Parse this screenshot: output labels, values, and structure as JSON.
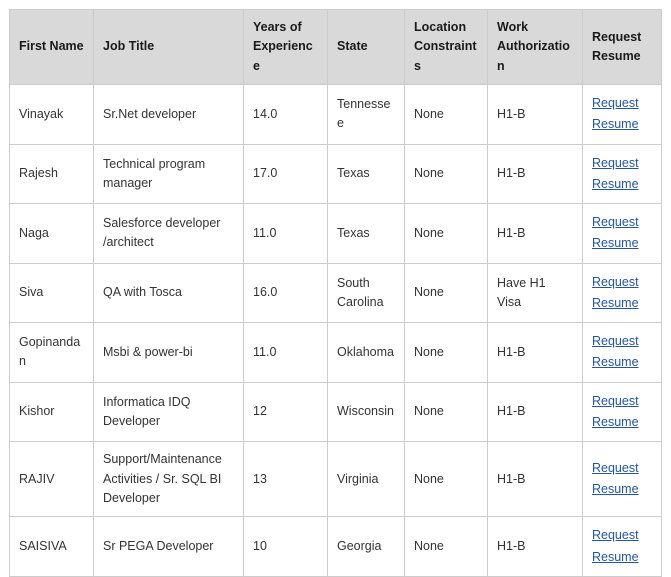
{
  "table": {
    "columns": [
      {
        "key": "first_name",
        "label": "First Name"
      },
      {
        "key": "job_title",
        "label": "Job Title"
      },
      {
        "key": "years",
        "label": "Years of Experience"
      },
      {
        "key": "state",
        "label": "State"
      },
      {
        "key": "location_constraints",
        "label": "Location Constraints"
      },
      {
        "key": "work_authorization",
        "label": "Work Authorization"
      },
      {
        "key": "request_resume",
        "label": "Request Resume"
      }
    ],
    "header": {
      "first_name": "First Name",
      "job_title": "Job Title",
      "years": "Years of Experience",
      "state": "State",
      "location_constraints": "Location Constraints",
      "work_authorization": "Work Authorization",
      "request_resume": "Request Resume"
    },
    "link_label": "Request Resume",
    "link_line_1": "Request",
    "link_line_2": "Resume",
    "link_color": "#2255aa",
    "header_bg": "#d9d9d9",
    "border_color": "#cccccc",
    "rows": [
      {
        "first_name": "Vinayak",
        "job_title": "Sr.Net developer",
        "years": "14.0",
        "state": "Tennessee",
        "location_constraints": "None",
        "work_authorization": "H1-B",
        "request_resume": "Request Resume"
      },
      {
        "first_name": "Rajesh",
        "job_title": "Technical program manager",
        "years": "17.0",
        "state": "Texas",
        "location_constraints": "None",
        "work_authorization": "H1-B",
        "request_resume": "Request Resume"
      },
      {
        "first_name": "Naga",
        "job_title": "Salesforce developer /architect",
        "years": "11.0",
        "state": "Texas",
        "location_constraints": "None",
        "work_authorization": "H1-B",
        "request_resume": "Request Resume"
      },
      {
        "first_name": "Siva",
        "job_title": "QA with Tosca",
        "years": "16.0",
        "state": "South Carolina",
        "location_constraints": "None",
        "work_authorization": "Have H1 Visa",
        "request_resume": "Request Resume"
      },
      {
        "first_name": "Gopinandan",
        "job_title": "Msbi & power-bi",
        "years": "11.0",
        "state": "Oklahoma",
        "location_constraints": "None",
        "work_authorization": "H1-B",
        "request_resume": "Request Resume"
      },
      {
        "first_name": "Kishor",
        "job_title": "Informatica IDQ Developer",
        "years": "12",
        "state": "Wisconsin",
        "location_constraints": "None",
        "work_authorization": "H1-B",
        "request_resume": "Request Resume"
      },
      {
        "first_name": "RAJIV",
        "job_title": "Support/Maintenance Activities / Sr. SQL BI Developer",
        "years": "13",
        "state": "Virginia",
        "location_constraints": "None",
        "work_authorization": "H1-B",
        "request_resume": "Request Resume"
      },
      {
        "first_name": "SAISIVA",
        "job_title": "Sr PEGA Developer",
        "years": "10",
        "state": "Georgia",
        "location_constraints": "None",
        "work_authorization": "H1-B",
        "request_resume": "Request Resume"
      }
    ]
  }
}
